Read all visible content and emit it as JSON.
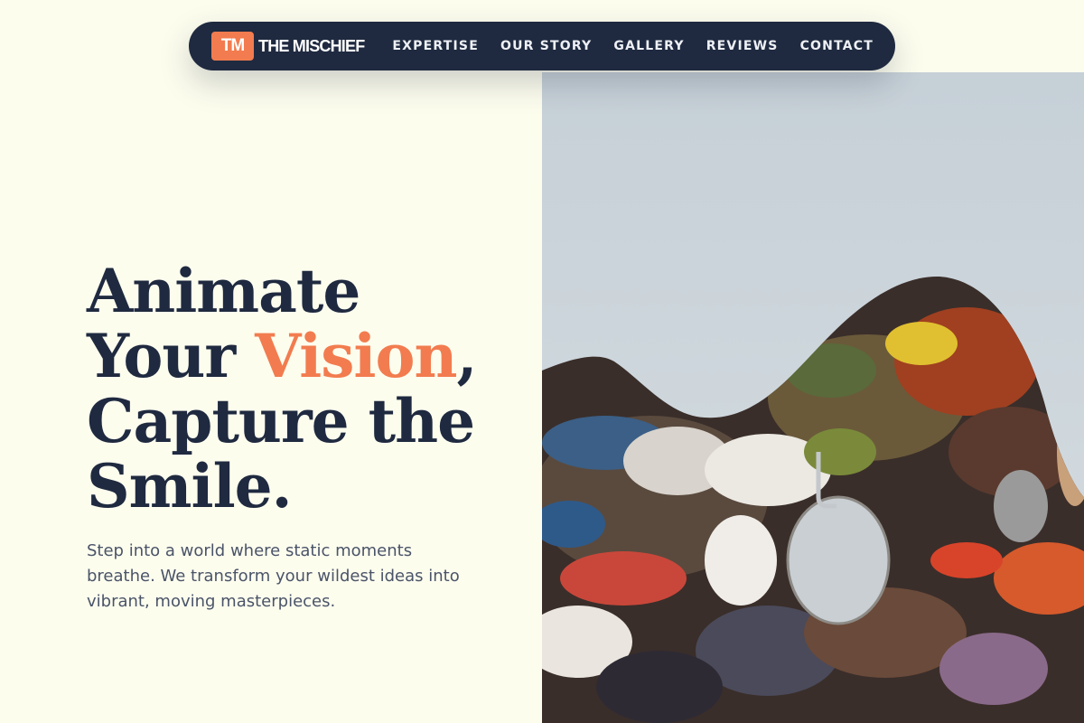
{
  "brand": {
    "badge": "TM",
    "name": "THE MISCHIEF"
  },
  "nav": {
    "links": [
      {
        "label": "EXPERTISE"
      },
      {
        "label": "OUR STORY"
      },
      {
        "label": "GALLERY"
      },
      {
        "label": "REVIEWS"
      },
      {
        "label": "CONTACT"
      }
    ]
  },
  "hero": {
    "headline_line1": "Animate",
    "headline_line2_pre": "Your ",
    "headline_accent": "Vision",
    "headline_line2_post": ",",
    "headline_line3": "Capture the",
    "headline_line4": "Smile.",
    "description": "Step into a world where static moments breathe. We transform your wildest ideas into vibrant, moving masterpieces."
  },
  "colors": {
    "background": "#fdfdee",
    "navy": "#1f2a40",
    "accent": "#f27c4f",
    "body_text": "#4a5468"
  },
  "image": {
    "subject": "paint-palette-photo"
  }
}
